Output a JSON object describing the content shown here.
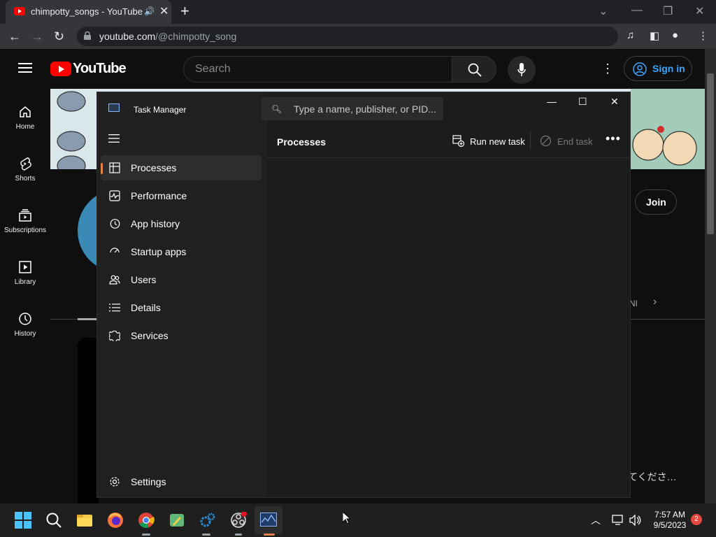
{
  "browser": {
    "tab_title": "chimpotty_songs - YouTube",
    "url_host": "youtube.com",
    "url_path": "/@chimpotty_song"
  },
  "youtube": {
    "logo_text": "YouTube",
    "search_placeholder": "Search",
    "signin_label": "Sign in",
    "join_label": "Join",
    "channel_tab_snippet": "NI",
    "japanese_snippet": "てくださ…",
    "nav": [
      {
        "label": "Home",
        "icon": "home-icon"
      },
      {
        "label": "Shorts",
        "icon": "shorts-icon"
      },
      {
        "label": "Subscriptions",
        "icon": "subscriptions-icon"
      },
      {
        "label": "Library",
        "icon": "library-icon"
      },
      {
        "label": "History",
        "icon": "history-icon"
      }
    ]
  },
  "task_manager": {
    "title": "Task Manager",
    "search_placeholder": "Type a name, publisher, or PID...",
    "page_title": "Processes",
    "run_new_task": "Run new task",
    "end_task": "End task",
    "nav": [
      {
        "label": "Processes",
        "icon": "processes-icon",
        "active": true
      },
      {
        "label": "Performance",
        "icon": "performance-icon"
      },
      {
        "label": "App history",
        "icon": "app-history-icon"
      },
      {
        "label": "Startup apps",
        "icon": "startup-apps-icon"
      },
      {
        "label": "Users",
        "icon": "users-icon"
      },
      {
        "label": "Details",
        "icon": "details-icon"
      },
      {
        "label": "Services",
        "icon": "services-icon"
      }
    ],
    "settings_label": "Settings"
  },
  "taskbar": {
    "time": "7:57 AM",
    "date": "9/5/2023",
    "notification_count": "2"
  },
  "colors": {
    "accent_orange": "#e8824c",
    "youtube_red": "#ff0000",
    "link_blue": "#3ea6ff"
  }
}
